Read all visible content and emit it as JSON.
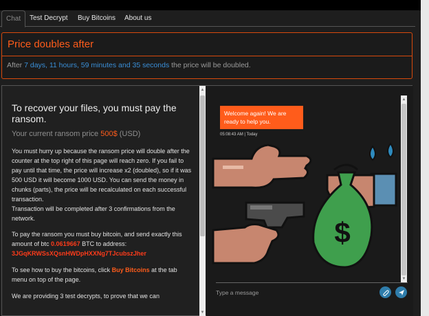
{
  "tabs": [
    {
      "label": "Chat",
      "active": true
    },
    {
      "label": "Test Decrypt"
    },
    {
      "label": "Buy Bitcoins"
    },
    {
      "label": "About us"
    }
  ],
  "price_panel": {
    "title": "Price doubles after",
    "prefix": "After ",
    "countdown": "7 days, 11 hours, 59 minutes and 35 seconds",
    "suffix": " the price will be doubled."
  },
  "left": {
    "heading": "To recover your files, you must pay the ransom.",
    "price_prefix": "Your current ransom price ",
    "price_value": "500$",
    "price_suffix": " (USD)",
    "para1": "You must hurry up because the ransom price will double after the counter at the top right of this page will reach zero. If you fail to pay until that time, the price will increase x2 (doubled), so if it was 500 USD it will become 1000 USD. You can send the money in chunks (parts), the price will be recalculated on each successful transaction.",
    "para2": "Transaction will be completed after 3 confirmations from the network.",
    "para3_prefix": "To pay the ransom you must buy bitcoin, and send exactly this amount of btc ",
    "btc_amount": "0.0619667",
    "para3_suffix": " BTC to address:",
    "btc_address": "3JGqKRWSsXQsnHWDpHXXNg7TJcubszJher",
    "para4_prefix": "To see how to buy the bitcoins, click ",
    "para4_link": "Buy Bitcoins",
    "para4_suffix": " at the tab menu on top of the page.",
    "para5": "We are providing 3 test decrypts, to prove that we can"
  },
  "chat": {
    "message": "Welcome again! We are ready to help you.",
    "timestamp": "05:08:43 AM | Today",
    "placeholder": "Type a message",
    "illustration_icon": "money-for-gun-illustration",
    "attach_icon": "paperclip-icon",
    "send_icon": "send-icon"
  },
  "colors": {
    "accent": "#ff5c1b",
    "countdown": "#3a8fd8",
    "panel_border": "#d94a0c",
    "button": "#2f7dab"
  }
}
